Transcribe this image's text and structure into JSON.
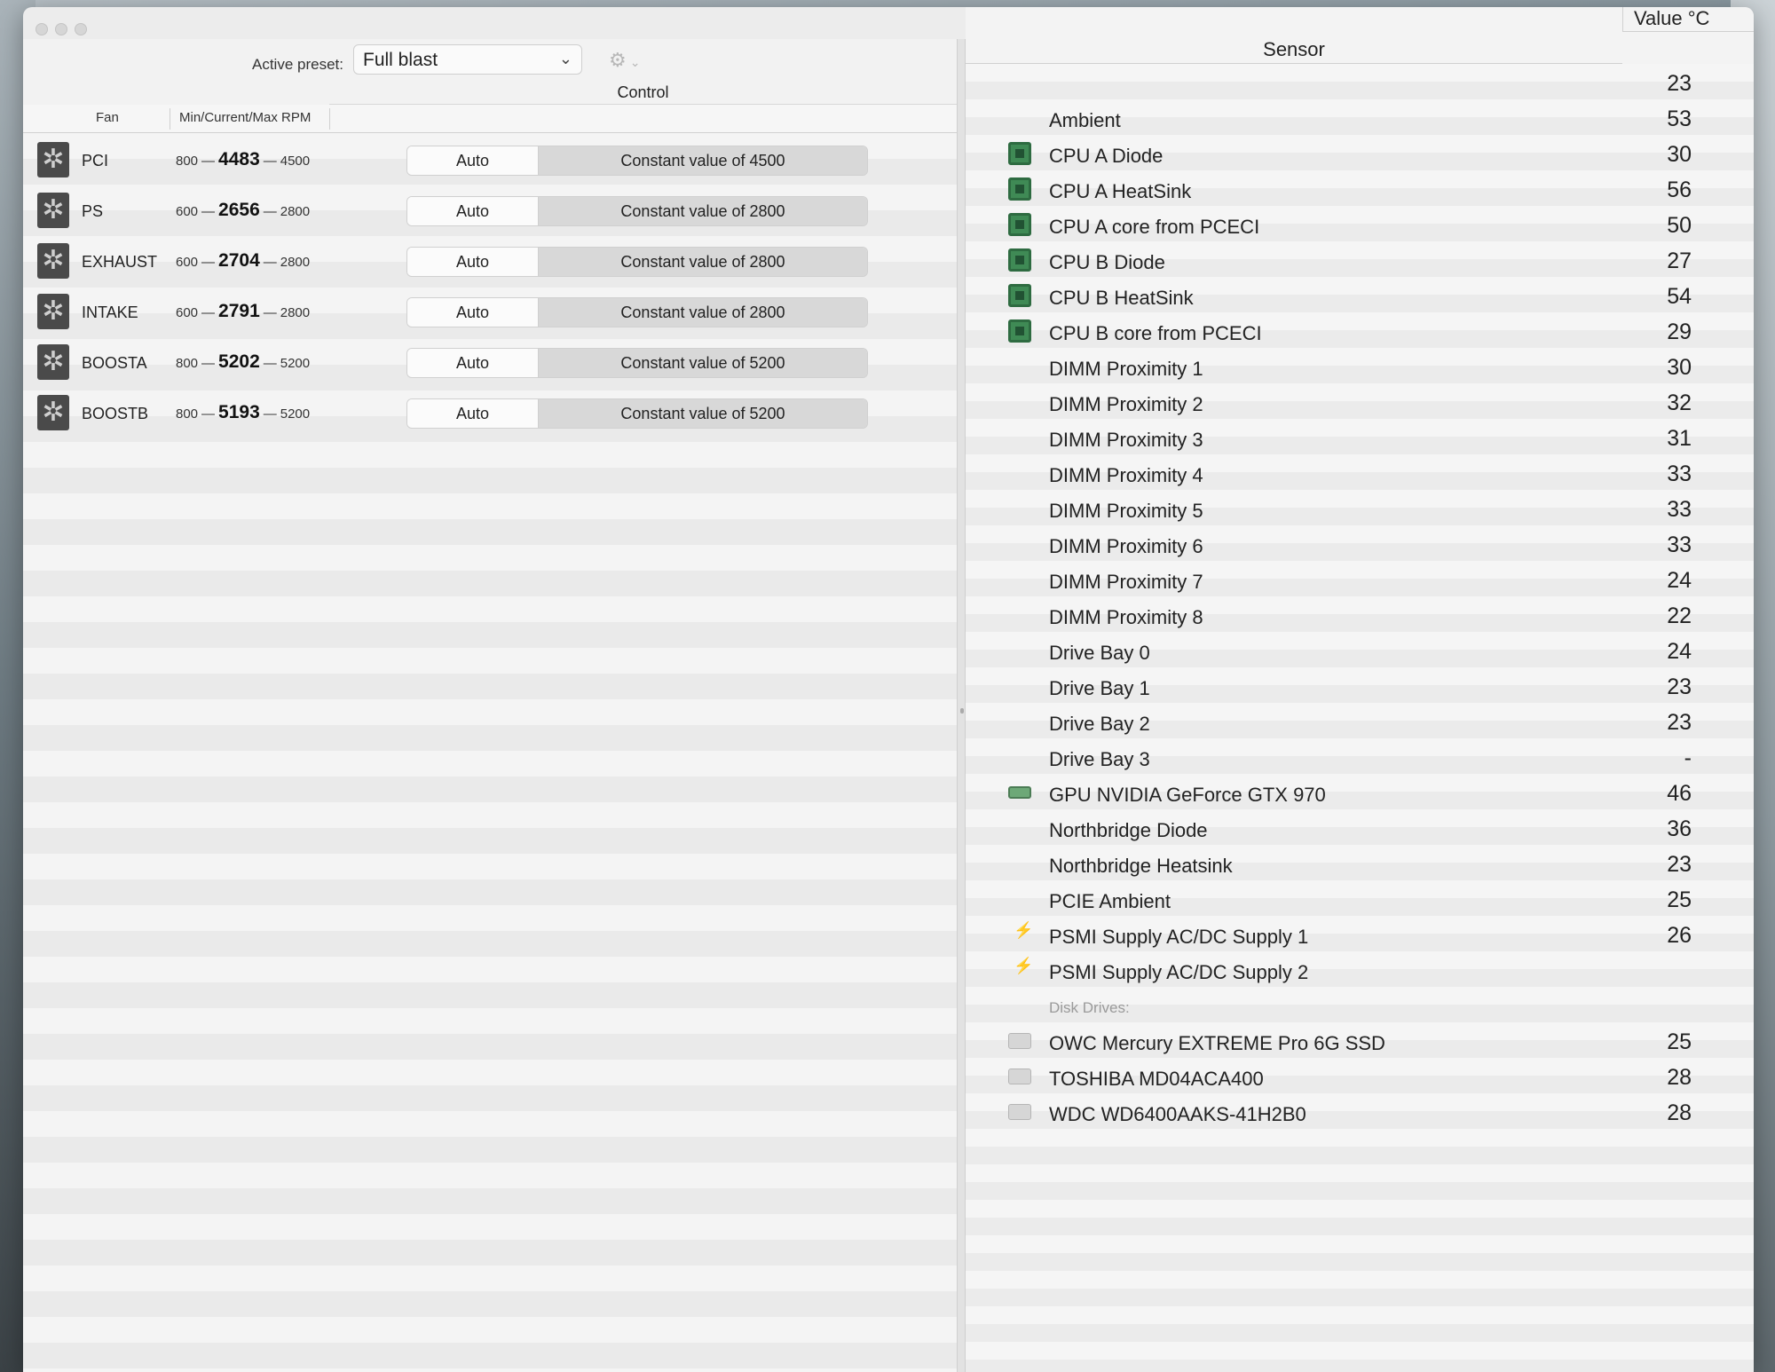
{
  "toolbar": {
    "preset_label": "Active preset:",
    "preset_value": "Full blast",
    "chevron": "⌄",
    "gear_icon": "gear-icon"
  },
  "fans": {
    "control_header": "Control",
    "col_fan": "Fan",
    "col_rpm": "Min/Current/Max RPM",
    "rows": [
      {
        "name": "PCI",
        "min": "800",
        "current": "4483",
        "max": "4500",
        "auto": "Auto",
        "control": "Constant value of 4500"
      },
      {
        "name": "PS",
        "min": "600",
        "current": "2656",
        "max": "2800",
        "auto": "Auto",
        "control": "Constant value of 2800"
      },
      {
        "name": "EXHAUST",
        "min": "600",
        "current": "2704",
        "max": "2800",
        "auto": "Auto",
        "control": "Constant value of 2800"
      },
      {
        "name": "INTAKE",
        "min": "600",
        "current": "2791",
        "max": "2800",
        "auto": "Auto",
        "control": "Constant value of 2800"
      },
      {
        "name": "BOOSTA",
        "min": "800",
        "current": "5202",
        "max": "5200",
        "auto": "Auto",
        "control": "Constant value of 5200"
      },
      {
        "name": "BOOSTB",
        "min": "800",
        "current": "5193",
        "max": "5200",
        "auto": "Auto",
        "control": "Constant value of 5200"
      }
    ]
  },
  "sensors": {
    "header": "Sensor",
    "value_header": "Value °C",
    "rows": [
      {
        "name": "",
        "value": "23",
        "icon": "none"
      },
      {
        "name": "Ambient",
        "value": "53",
        "icon": "none"
      },
      {
        "name": "CPU A Diode",
        "value": "30",
        "icon": "chip"
      },
      {
        "name": "CPU A HeatSink",
        "value": "56",
        "icon": "chip"
      },
      {
        "name": "CPU A core from PCECI",
        "value": "50",
        "icon": "chip"
      },
      {
        "name": "CPU B Diode",
        "value": "27",
        "icon": "chip"
      },
      {
        "name": "CPU B HeatSink",
        "value": "54",
        "icon": "chip"
      },
      {
        "name": "CPU B core from PCECI",
        "value": "29",
        "icon": "chip"
      },
      {
        "name": "DIMM Proximity 1",
        "value": "30",
        "icon": "none"
      },
      {
        "name": "DIMM Proximity 2",
        "value": "32",
        "icon": "none"
      },
      {
        "name": "DIMM Proximity 3",
        "value": "31",
        "icon": "none"
      },
      {
        "name": "DIMM Proximity 4",
        "value": "33",
        "icon": "none"
      },
      {
        "name": "DIMM Proximity 5",
        "value": "33",
        "icon": "none"
      },
      {
        "name": "DIMM Proximity 6",
        "value": "33",
        "icon": "none"
      },
      {
        "name": "DIMM Proximity 7",
        "value": "24",
        "icon": "none"
      },
      {
        "name": "DIMM Proximity 8",
        "value": "22",
        "icon": "none"
      },
      {
        "name": "Drive Bay 0",
        "value": "24",
        "icon": "none"
      },
      {
        "name": "Drive Bay 1",
        "value": "23",
        "icon": "none"
      },
      {
        "name": "Drive Bay 2",
        "value": "23",
        "icon": "none"
      },
      {
        "name": "Drive Bay 3",
        "value": "-",
        "icon": "none"
      },
      {
        "name": "GPU NVIDIA GeForce GTX 970",
        "value": "46",
        "icon": "gpu"
      },
      {
        "name": "Northbridge Diode",
        "value": "36",
        "icon": "none"
      },
      {
        "name": "Northbridge Heatsink",
        "value": "23",
        "icon": "none"
      },
      {
        "name": "PCIE Ambient",
        "value": "25",
        "icon": "none"
      },
      {
        "name": "PSMI Supply AC/DC Supply 1",
        "value": "26",
        "icon": "power"
      },
      {
        "name": "PSMI Supply AC/DC Supply 2",
        "value": "",
        "icon": "power"
      },
      {
        "name": "Disk Drives:",
        "value": "",
        "icon": "group"
      },
      {
        "name": "OWC Mercury EXTREME Pro 6G SSD",
        "value": "25",
        "icon": "disk"
      },
      {
        "name": "TOSHIBA MD04ACA400",
        "value": "28",
        "icon": "disk"
      },
      {
        "name": "WDC WD6400AAKS-41H2B0",
        "value": "28",
        "icon": "disk"
      }
    ]
  }
}
